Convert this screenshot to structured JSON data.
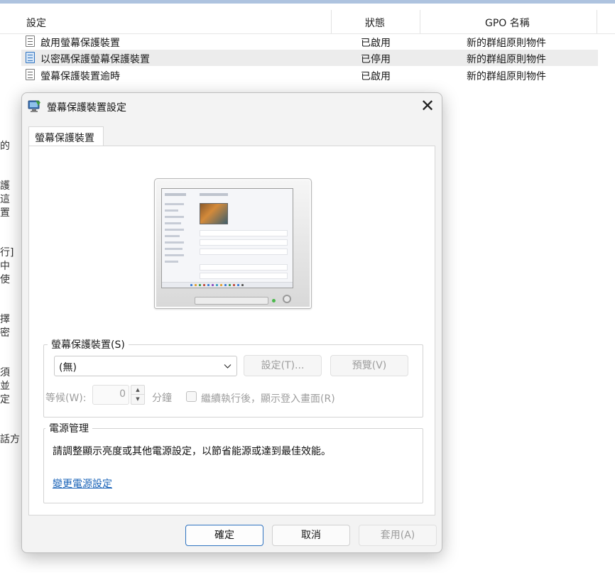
{
  "background": {
    "columns": {
      "setting": "設定",
      "state": "狀態",
      "gpo": "GPO 名稱"
    },
    "rows": [
      {
        "name": "啟用螢幕保護裝置",
        "state": "已啟用",
        "gpo": "新的群組原則物件",
        "selected": false
      },
      {
        "name": "以密碼保護螢幕保護裝置",
        "state": "已停用",
        "gpo": "新的群組原則物件",
        "selected": true
      },
      {
        "name": "螢幕保護裝置逾時",
        "state": "已啟用",
        "gpo": "新的群組原則物件",
        "selected": false
      }
    ],
    "left_fragments": [
      "的",
      "護",
      "這",
      "置",
      "行]",
      "中",
      "使",
      "擇",
      "密",
      "須",
      "並",
      "定",
      "話方"
    ]
  },
  "dialog": {
    "title": "螢幕保護裝置設定",
    "close_glyph": "✕",
    "tab_label": "螢幕保護裝置",
    "screensaver_group": {
      "title": "螢幕保護裝置(S)",
      "selected_value": "(無)",
      "settings_button": "設定(T)...",
      "preview_button": "預覽(V)",
      "wait_label": "等候(W):",
      "wait_value": "0",
      "minutes_label": "分鐘",
      "resume_checkbox_label": "繼續執行後，顯示登入畫面(R)",
      "resume_checked": false
    },
    "power_group": {
      "title": "電源管理",
      "description": "請調整顯示亮度或其他電源設定，以節省能源或達到最佳效能。",
      "link": "變更電源設定"
    },
    "buttons": {
      "ok": "確定",
      "cancel": "取消",
      "apply": "套用(A)"
    }
  },
  "colors": {
    "accent": "#2f73c0",
    "link": "#1a63b8",
    "disabled_text": "#9d9d9d",
    "selected_row": "#ececec"
  }
}
